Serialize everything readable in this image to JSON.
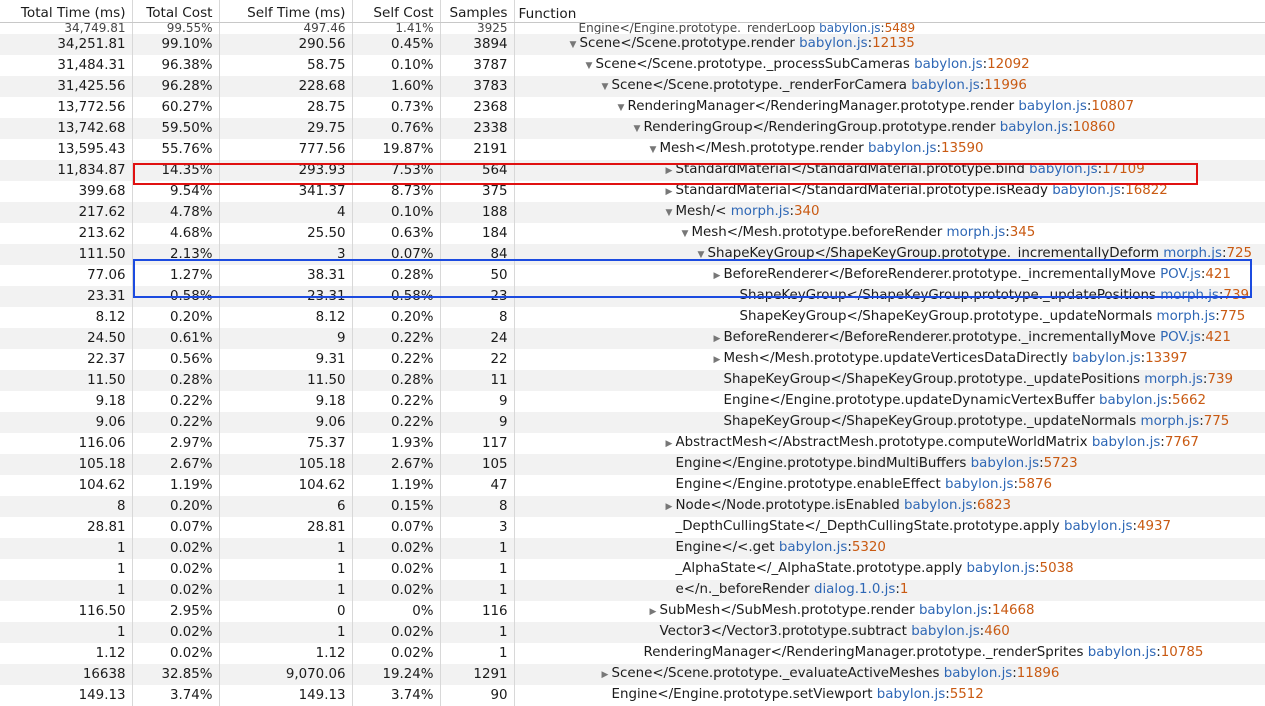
{
  "columns": {
    "total_time": "Total Time (ms)",
    "total_cost": "Total Cost",
    "self_time": "Self Time (ms)",
    "self_cost": "Self Cost",
    "samples": "Samples",
    "function": "Function"
  },
  "top_fragment": {
    "total_time": "34,749.81",
    "total_cost": "99.55%",
    "self_time": "497.46",
    "self_cost": "1.41%",
    "samples": "3925",
    "fn": "Engine</Engine.prototype._renderLoop",
    "src": "babylon.js",
    "line": "5489"
  },
  "rows": [
    {
      "tt": "34,251.81",
      "tc": "99.10%",
      "st": "290.56",
      "sc": "0.45%",
      "sm": "3894",
      "depth": 0,
      "tw": "open",
      "fn": "Scene</Scene.prototype.render",
      "src": "babylon.js",
      "line": "12135"
    },
    {
      "tt": "31,484.31",
      "tc": "96.38%",
      "st": "58.75",
      "sc": "0.10%",
      "sm": "3787",
      "depth": 1,
      "tw": "open",
      "fn": "Scene</Scene.prototype._processSubCameras",
      "src": "babylon.js",
      "line": "12092"
    },
    {
      "tt": "31,425.56",
      "tc": "96.28%",
      "st": "228.68",
      "sc": "1.60%",
      "sm": "3783",
      "depth": 2,
      "tw": "open",
      "fn": "Scene</Scene.prototype._renderForCamera",
      "src": "babylon.js",
      "line": "11996"
    },
    {
      "tt": "13,772.56",
      "tc": "60.27%",
      "st": "28.75",
      "sc": "0.73%",
      "sm": "2368",
      "depth": 3,
      "tw": "open",
      "fn": "RenderingManager</RenderingManager.prototype.render",
      "src": "babylon.js",
      "line": "10807"
    },
    {
      "tt": "13,742.68",
      "tc": "59.50%",
      "st": "29.75",
      "sc": "0.76%",
      "sm": "2338",
      "depth": 4,
      "tw": "open",
      "fn": "RenderingGroup</RenderingGroup.prototype.render",
      "src": "babylon.js",
      "line": "10860"
    },
    {
      "tt": "13,595.43",
      "tc": "55.76%",
      "st": "777.56",
      "sc": "19.87%",
      "sm": "2191",
      "depth": 5,
      "tw": "open",
      "fn": "Mesh</Mesh.prototype.render",
      "src": "babylon.js",
      "line": "13590"
    },
    {
      "tt": "11,834.87",
      "tc": "14.35%",
      "st": "293.93",
      "sc": "7.53%",
      "sm": "564",
      "depth": 6,
      "tw": "closed",
      "fn": "StandardMaterial</StandardMaterial.prototype.bind",
      "src": "babylon.js",
      "line": "17109"
    },
    {
      "tt": "399.68",
      "tc": "9.54%",
      "st": "341.37",
      "sc": "8.73%",
      "sm": "375",
      "depth": 6,
      "tw": "closed",
      "fn": "StandardMaterial</StandardMaterial.prototype.isReady",
      "src": "babylon.js",
      "line": "16822"
    },
    {
      "tt": "217.62",
      "tc": "4.78%",
      "st": "4",
      "sc": "0.10%",
      "sm": "188",
      "depth": 6,
      "tw": "open",
      "fn": "Mesh/<",
      "src": "morph.js",
      "line": "340"
    },
    {
      "tt": "213.62",
      "tc": "4.68%",
      "st": "25.50",
      "sc": "0.63%",
      "sm": "184",
      "depth": 7,
      "tw": "open",
      "fn": "Mesh</Mesh.prototype.beforeRender",
      "src": "morph.js",
      "line": "345"
    },
    {
      "tt": "111.50",
      "tc": "2.13%",
      "st": "3",
      "sc": "0.07%",
      "sm": "84",
      "depth": 8,
      "tw": "open",
      "fn": "ShapeKeyGroup</ShapeKeyGroup.prototype._incrementallyDeform",
      "src": "morph.js",
      "line": "725"
    },
    {
      "tt": "77.06",
      "tc": "1.27%",
      "st": "38.31",
      "sc": "0.28%",
      "sm": "50",
      "depth": 9,
      "tw": "closed",
      "fn": "BeforeRenderer</BeforeRenderer.prototype._incrementallyMove",
      "src": "POV.js",
      "line": "421"
    },
    {
      "tt": "23.31",
      "tc": "0.58%",
      "st": "23.31",
      "sc": "0.58%",
      "sm": "23",
      "depth": 10,
      "tw": "none",
      "fn": "ShapeKeyGroup</ShapeKeyGroup.prototype._updatePositions",
      "src": "morph.js",
      "line": "739"
    },
    {
      "tt": "8.12",
      "tc": "0.20%",
      "st": "8.12",
      "sc": "0.20%",
      "sm": "8",
      "depth": 10,
      "tw": "none",
      "fn": "ShapeKeyGroup</ShapeKeyGroup.prototype._updateNormals",
      "src": "morph.js",
      "line": "775"
    },
    {
      "tt": "24.50",
      "tc": "0.61%",
      "st": "9",
      "sc": "0.22%",
      "sm": "24",
      "depth": 9,
      "tw": "closed",
      "fn": "BeforeRenderer</BeforeRenderer.prototype._incrementallyMove",
      "src": "POV.js",
      "line": "421"
    },
    {
      "tt": "22.37",
      "tc": "0.56%",
      "st": "9.31",
      "sc": "0.22%",
      "sm": "22",
      "depth": 9,
      "tw": "closed",
      "fn": "Mesh</Mesh.prototype.updateVerticesDataDirectly",
      "src": "babylon.js",
      "line": "13397"
    },
    {
      "tt": "11.50",
      "tc": "0.28%",
      "st": "11.50",
      "sc": "0.28%",
      "sm": "11",
      "depth": 9,
      "tw": "none",
      "fn": "ShapeKeyGroup</ShapeKeyGroup.prototype._updatePositions",
      "src": "morph.js",
      "line": "739"
    },
    {
      "tt": "9.18",
      "tc": "0.22%",
      "st": "9.18",
      "sc": "0.22%",
      "sm": "9",
      "depth": 9,
      "tw": "none",
      "fn": "Engine</Engine.prototype.updateDynamicVertexBuffer",
      "src": "babylon.js",
      "line": "5662"
    },
    {
      "tt": "9.06",
      "tc": "0.22%",
      "st": "9.06",
      "sc": "0.22%",
      "sm": "9",
      "depth": 9,
      "tw": "none",
      "fn": "ShapeKeyGroup</ShapeKeyGroup.prototype._updateNormals",
      "src": "morph.js",
      "line": "775"
    },
    {
      "tt": "116.06",
      "tc": "2.97%",
      "st": "75.37",
      "sc": "1.93%",
      "sm": "117",
      "depth": 6,
      "tw": "closed",
      "fn": "AbstractMesh</AbstractMesh.prototype.computeWorldMatrix",
      "src": "babylon.js",
      "line": "7767"
    },
    {
      "tt": "105.18",
      "tc": "2.67%",
      "st": "105.18",
      "sc": "2.67%",
      "sm": "105",
      "depth": 6,
      "tw": "none",
      "fn": "Engine</Engine.prototype.bindMultiBuffers",
      "src": "babylon.js",
      "line": "5723"
    },
    {
      "tt": "104.62",
      "tc": "1.19%",
      "st": "104.62",
      "sc": "1.19%",
      "sm": "47",
      "depth": 6,
      "tw": "none",
      "fn": "Engine</Engine.prototype.enableEffect",
      "src": "babylon.js",
      "line": "5876"
    },
    {
      "tt": "8",
      "tc": "0.20%",
      "st": "6",
      "sc": "0.15%",
      "sm": "8",
      "depth": 6,
      "tw": "closed",
      "fn": "Node</Node.prototype.isEnabled",
      "src": "babylon.js",
      "line": "6823"
    },
    {
      "tt": "28.81",
      "tc": "0.07%",
      "st": "28.81",
      "sc": "0.07%",
      "sm": "3",
      "depth": 6,
      "tw": "none",
      "fn": "_DepthCullingState</_DepthCullingState.prototype.apply",
      "src": "babylon.js",
      "line": "4937"
    },
    {
      "tt": "1",
      "tc": "0.02%",
      "st": "1",
      "sc": "0.02%",
      "sm": "1",
      "depth": 6,
      "tw": "none",
      "fn": "Engine</<.get",
      "src": "babylon.js",
      "line": "5320"
    },
    {
      "tt": "1",
      "tc": "0.02%",
      "st": "1",
      "sc": "0.02%",
      "sm": "1",
      "depth": 6,
      "tw": "none",
      "fn": "_AlphaState</_AlphaState.prototype.apply",
      "src": "babylon.js",
      "line": "5038"
    },
    {
      "tt": "1",
      "tc": "0.02%",
      "st": "1",
      "sc": "0.02%",
      "sm": "1",
      "depth": 6,
      "tw": "none",
      "fn": "e</n._beforeRender",
      "src": "dialog.1.0.js",
      "line": "1"
    },
    {
      "tt": "116.50",
      "tc": "2.95%",
      "st": "0",
      "sc": "0%",
      "sm": "116",
      "depth": 5,
      "tw": "closed",
      "fn": "SubMesh</SubMesh.prototype.render",
      "src": "babylon.js",
      "line": "14668"
    },
    {
      "tt": "1",
      "tc": "0.02%",
      "st": "1",
      "sc": "0.02%",
      "sm": "1",
      "depth": 5,
      "tw": "none",
      "fn": "Vector3</Vector3.prototype.subtract",
      "src": "babylon.js",
      "line": "460"
    },
    {
      "tt": "1.12",
      "tc": "0.02%",
      "st": "1.12",
      "sc": "0.02%",
      "sm": "1",
      "depth": 4,
      "tw": "none",
      "fn": "RenderingManager</RenderingManager.prototype._renderSprites",
      "src": "babylon.js",
      "line": "10785"
    },
    {
      "tt": "16638",
      "tc": "32.85%",
      "st": "9,070.06",
      "sc": "19.24%",
      "sm": "1291",
      "depth": 2,
      "tw": "closed",
      "fn": "Scene</Scene.prototype._evaluateActiveMeshes",
      "src": "babylon.js",
      "line": "11896"
    },
    {
      "tt": "149.13",
      "tc": "3.74%",
      "st": "149.13",
      "sc": "3.74%",
      "sm": "90",
      "depth": 2,
      "tw": "none",
      "fn": "Engine</Engine.prototype.setViewport",
      "src": "babylon.js",
      "line": "5512"
    }
  ]
}
